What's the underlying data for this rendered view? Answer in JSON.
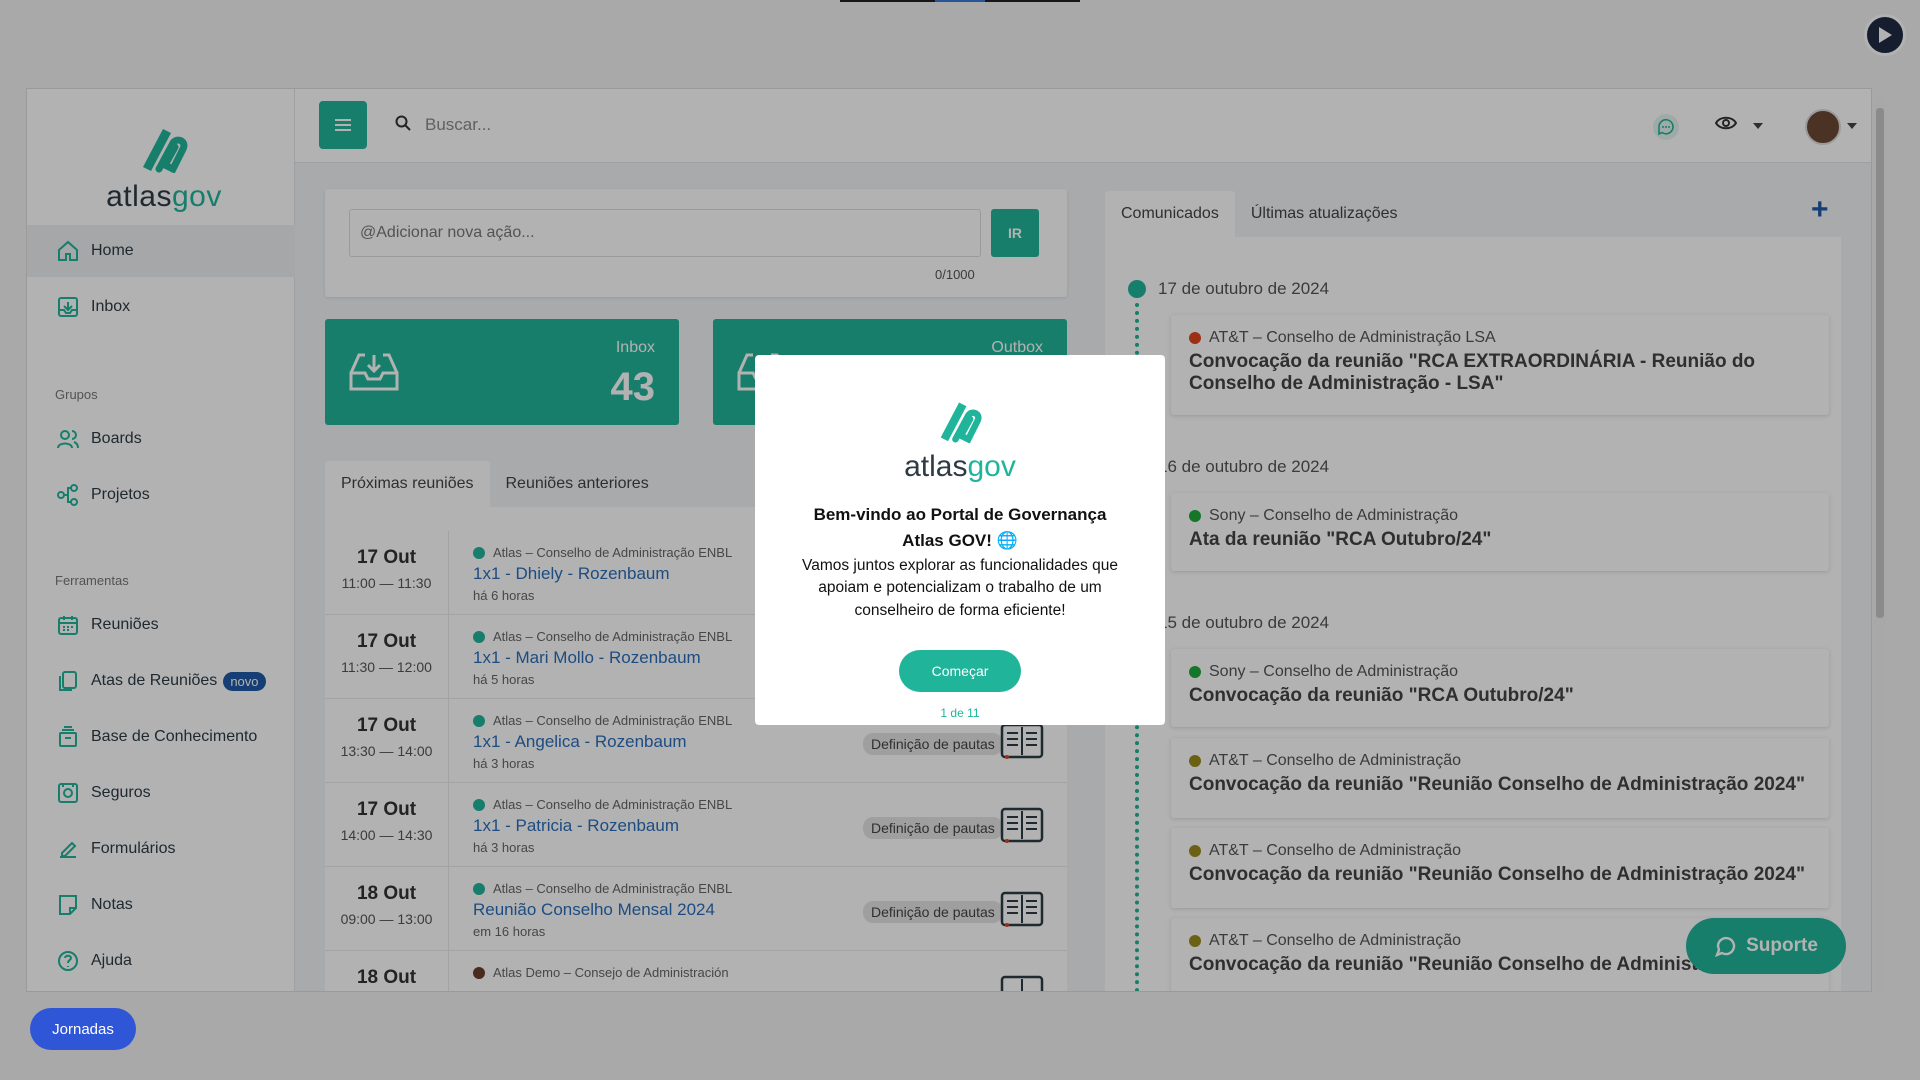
{
  "brand": {
    "name_part1": "atlas",
    "name_part2": "gov",
    "accent": "#20b59a"
  },
  "sidebar": {
    "items": [
      {
        "label": "Home",
        "icon": "home-icon"
      },
      {
        "label": "Inbox",
        "icon": "inbox-icon"
      }
    ],
    "groups_label": "Grupos",
    "group_items": [
      {
        "label": "Boards",
        "icon": "users-icon"
      },
      {
        "label": "Projetos",
        "icon": "project-icon"
      }
    ],
    "tools_label": "Ferramentas",
    "tool_items": [
      {
        "label": "Reuniões",
        "icon": "calendar-icon"
      },
      {
        "label": "Atas de Reuniões",
        "icon": "copy-icon",
        "badge": "novo"
      },
      {
        "label": "Base de Conhecimento",
        "icon": "archive-icon"
      },
      {
        "label": "Seguros",
        "icon": "safe-icon"
      },
      {
        "label": "Formulários",
        "icon": "form-icon"
      },
      {
        "label": "Notas",
        "icon": "note-icon"
      },
      {
        "label": "Ajuda",
        "icon": "help-icon"
      }
    ]
  },
  "header": {
    "search_placeholder": "Buscar..."
  },
  "action": {
    "placeholder": "@Adicionar nova ação...",
    "counter": "0/1000",
    "button": "IR"
  },
  "stats": [
    {
      "label": "Inbox",
      "value": "43"
    },
    {
      "label": "Outbox",
      "value": ""
    }
  ],
  "meetings_tabs": [
    "Próximas reuniões",
    "Reuniões anteriores"
  ],
  "meetings": [
    {
      "day": "17 Out",
      "time": "11:00 — 11:30",
      "board": "Atlas – Conselho de Administração ENBL",
      "title": "1x1 - Dhiely - Rozenbaum",
      "ago": "há 6 horas",
      "tag": "",
      "dot": "#20b59a"
    },
    {
      "day": "17 Out",
      "time": "11:30 — 12:00",
      "board": "Atlas – Conselho de Administração ENBL",
      "title": "1x1 - Mari Mollo - Rozenbaum",
      "ago": "há 5 horas",
      "tag": "",
      "dot": "#20b59a"
    },
    {
      "day": "17 Out",
      "time": "13:30 — 14:00",
      "board": "Atlas – Conselho de Administração ENBL",
      "title": "1x1 - Angelica - Rozenbaum",
      "ago": "há 3 horas",
      "tag": "Definição de pautas",
      "dot": "#20b59a"
    },
    {
      "day": "17 Out",
      "time": "14:00 — 14:30",
      "board": "Atlas – Conselho de Administração ENBL",
      "title": "1x1 - Patricia - Rozenbaum",
      "ago": "há 3 horas",
      "tag": "Definição de pautas",
      "dot": "#20b59a"
    },
    {
      "day": "18 Out",
      "time": "09:00 — 13:00",
      "board": "Atlas – Conselho de Administração ENBL",
      "title": "Reunião Conselho Mensal 2024",
      "ago": "em 16 horas",
      "tag": "Definição de pautas",
      "dot": "#20b59a"
    },
    {
      "day": "18 Out",
      "time": "",
      "board": "Atlas Demo – Consejo de Administración",
      "title": "",
      "ago": "",
      "tag": "",
      "dot": "#6b3e2e"
    }
  ],
  "right_tabs": [
    "Comunicados",
    "Últimas atualizações"
  ],
  "timeline": {
    "dates": [
      "17 de outubro de 2024",
      "16 de outubro de 2024",
      "15 de outubro de 2024"
    ],
    "cards": [
      {
        "board": "AT&T – Conselho de Administração LSA",
        "title": "Convocação da reunião \"RCA EXTRAORDINÁRIA - Reunião do Conselho de Administração - LSA\"",
        "dot": "#e0451f"
      },
      {
        "board": "Sony – Conselho de Administração",
        "title": "Ata da reunião \"RCA Outubro/24\"",
        "dot": "#1fa83a"
      },
      {
        "board": "Sony – Conselho de Administração",
        "title": "Convocação da reunião \"RCA Outubro/24\"",
        "dot": "#1fa83a"
      },
      {
        "board": "AT&T – Conselho de Administração",
        "title": "Convocação da reunião \"Reunião Conselho de Administração 2024\"",
        "dot": "#9a8a1e"
      },
      {
        "board": "AT&T – Conselho de Administração",
        "title": "Convocação da reunião \"Reunião Conselho de Administração 2024\"",
        "dot": "#9a8a1e"
      },
      {
        "board": "AT&T – Conselho de Administração",
        "title": "Convocação da reunião \"Reunião Conselho de Administraç",
        "dot": "#9a8a1e"
      }
    ]
  },
  "modal": {
    "title": "Bem-vindo ao Portal de Governança Atlas GOV! 🌐",
    "text": "Vamos juntos explorar as funcionalidades que apoiam e potencializam o trabalho de um conselheiro de forma eficiente!",
    "button": "Começar",
    "step": "1 de 11"
  },
  "floating": {
    "jornadas": "Jornadas",
    "suporte": "Suporte"
  }
}
